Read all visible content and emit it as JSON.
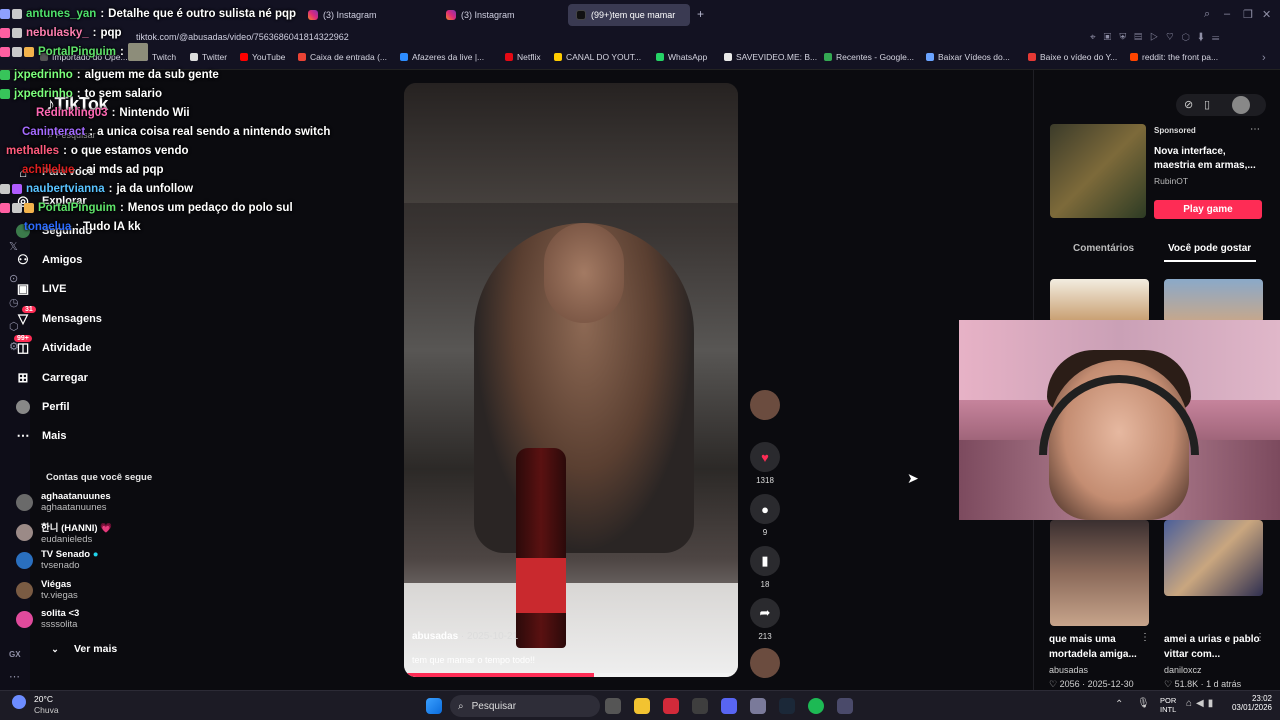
{
  "browser": {
    "tabs": [
      {
        "label": "(3) Instagram"
      },
      {
        "label": "(3) Instagram"
      },
      {
        "label": "(99+)tem que mamar"
      }
    ],
    "url": "tiktok.com/@abusadas/video/7563686041814322962",
    "bookmarks": [
      "Importado do Ope...",
      "Twitch",
      "Twitter",
      "YouTube",
      "Caixa de entrada (...",
      "Afazeres da live |...",
      "Netflix",
      "CANAL DO YOUT...",
      "WhatsApp",
      "SAVEVIDEO.ME: B...",
      "Recentes - Google...",
      "Baixar Vídeos do...",
      "Baixe o vídeo do Y...",
      "reddit: the front pa..."
    ]
  },
  "tiktok": {
    "logo": "TikTok",
    "search_placeholder": "Pesquisar",
    "nav": [
      {
        "label": "Para você",
        "icon": "home-icon"
      },
      {
        "label": "Explorar",
        "icon": "compass-icon"
      },
      {
        "label": "Seguindo",
        "icon": "following-icon"
      },
      {
        "label": "Amigos",
        "icon": "friends-icon"
      },
      {
        "label": "LIVE",
        "icon": "live-icon"
      },
      {
        "label": "Mensagens",
        "icon": "messages-icon",
        "badge": "31"
      },
      {
        "label": "Atividade",
        "icon": "activity-icon",
        "badge": "99+"
      },
      {
        "label": "Carregar",
        "icon": "upload-icon"
      },
      {
        "label": "Perfil",
        "icon": "profile-icon"
      },
      {
        "label": "Mais",
        "icon": "more-icon"
      }
    ],
    "following_title": "Contas que você segue",
    "following": [
      {
        "name": "aghaatanuunes",
        "handle": "aghaatanuunes",
        "color": "#6a6a6a"
      },
      {
        "name": "한니 (HANNI) 💗",
        "handle": "eudanieleds",
        "color": "#9b8a87"
      },
      {
        "name": "TV Senado",
        "handle": "tvsenado",
        "color": "#2a6fbf",
        "verified": true
      },
      {
        "name": "Viégas",
        "handle": "tv.viegas",
        "color": "#7a5b43"
      },
      {
        "name": "solita <3",
        "handle": "ssssolita",
        "color": "#e04a9c"
      }
    ],
    "see_more": "Ver mais",
    "video": {
      "author": "abusadas",
      "date": "2025-10-21",
      "caption": "tem que mamar o tempo todo!!",
      "progress": 0.57
    },
    "actions": {
      "likes": "1318",
      "comments": "9",
      "saves": "18",
      "shares": "213"
    },
    "sponsored": {
      "label": "Sponsored",
      "title": "Nova interface, maestria em armas,...",
      "advertiser": "RubinOT",
      "cta": "Play game"
    },
    "right_tabs": [
      "Comentários",
      "Você pode gostar"
    ],
    "cards": [
      {
        "title": "que mais uma mortadela amiga...",
        "author": "abusadas",
        "likes": "2056",
        "date": "2025-12-30"
      },
      {
        "title": "amei a urias e pablo vittar com...",
        "author": "daniloxcz",
        "likes": "51.8K",
        "date": "1 d atrás"
      }
    ]
  },
  "chat": [
    {
      "user": "antunes_yan",
      "color": "#4ee06b",
      "msg": "Detalhe que é outro sulista né pqp"
    },
    {
      "user": "nebulasky_",
      "color": "#ff7fb0",
      "msg": "pqp"
    },
    {
      "user": "PortalPinguim",
      "color": "#5fe36a",
      "msg": ""
    },
    {
      "user": "jxpedrinho",
      "color": "#7cff7c",
      "msg": "alguem me da sub gente"
    },
    {
      "user": "jxpedrinho",
      "color": "#7cff7c",
      "msg": "to sem salario"
    },
    {
      "user": "Redinkling03",
      "color": "#ff69b4",
      "msg": "Nintendo Wii"
    },
    {
      "user": "Caninteract",
      "color": "#a56bff",
      "msg": "a unica coisa real sendo a nintendo switch"
    },
    {
      "user": "methalles",
      "color": "#ff5b7c",
      "msg": "o que estamos vendo"
    },
    {
      "user": "achillelue",
      "color": "#e02020",
      "msg": "ai mds ad pqp"
    },
    {
      "user": "naubertvianna",
      "color": "#59c3ff",
      "msg": "ja da unfollow"
    },
    {
      "user": "PortalPinguim",
      "color": "#5fe36a",
      "msg": "Menos um pedaço do polo sul"
    },
    {
      "user": "tonaelua",
      "color": "#2d6cff",
      "msg": "Tudo IA kk"
    }
  ],
  "taskbar": {
    "weather_temp": "20°C",
    "weather_desc": "Chuva",
    "search": "Pesquisar",
    "lang": "POR",
    "layout": "INTL",
    "time": "23:02",
    "date": "03/01/2026"
  }
}
